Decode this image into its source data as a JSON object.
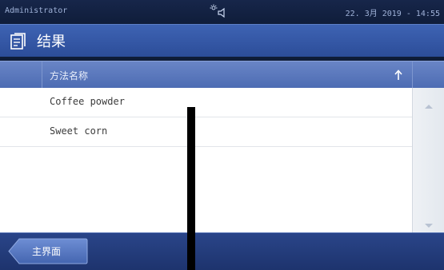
{
  "status_bar": {
    "user": "Administrator",
    "datetime": "22. 3月 2019 - 14:55",
    "system_icon": "light-speaker-icon"
  },
  "header": {
    "title": "结果",
    "icon": "results-document-icon"
  },
  "table": {
    "column_header": "方法名称",
    "sort_direction": "ascending",
    "rows": [
      {
        "name": "Coffee powder"
      },
      {
        "name": "Sweet corn"
      }
    ]
  },
  "footer": {
    "home_button_label": "主界面"
  },
  "colors": {
    "header_blue": "#3e63b3",
    "table_header_blue": "#5d79bd",
    "bottom_bar_blue": "#2a4589",
    "status_bar": "#17264a"
  }
}
